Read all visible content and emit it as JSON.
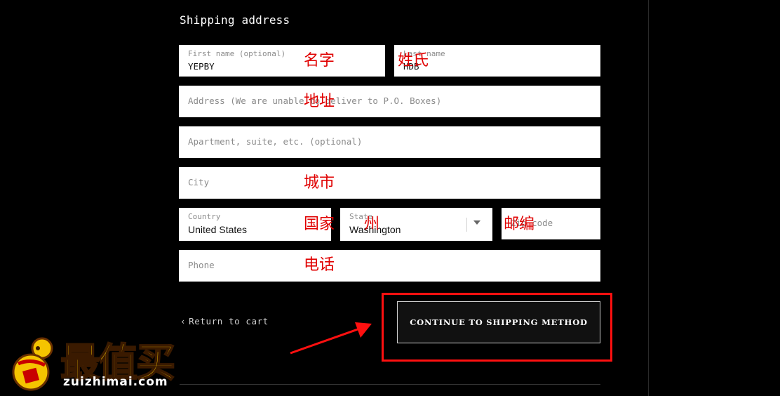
{
  "section_title": "Shipping address",
  "fields": {
    "first_name": {
      "label": "First name (optional)",
      "value": "YEPBY",
      "annotation": "名字"
    },
    "last_name": {
      "label": "Last name",
      "value": "HDB",
      "annotation": "姓氏"
    },
    "address": {
      "placeholder": "Address (We are unable to deliver to P.O. Boxes)",
      "annotation": "地址"
    },
    "apartment": {
      "placeholder": "Apartment, suite, etc. (optional)"
    },
    "city": {
      "placeholder": "City",
      "annotation": "城市"
    },
    "country": {
      "label": "Country",
      "value": "United States",
      "annotation": "国家"
    },
    "state": {
      "label": "State",
      "value": "Washington",
      "annotation": "州"
    },
    "zip": {
      "placeholder": "Zip code",
      "annotation": "邮编"
    },
    "phone": {
      "placeholder": "Phone",
      "annotation": "电话"
    }
  },
  "return_link": "Return to cart",
  "continue_button": "CONTINUE TO SHIPPING METHOD",
  "watermark": {
    "main": "最值买",
    "sub": "zuizhimai.com"
  },
  "colors": {
    "annotation": "#e00000",
    "highlight_box": "#ff1010",
    "logo": "#f5c400"
  }
}
